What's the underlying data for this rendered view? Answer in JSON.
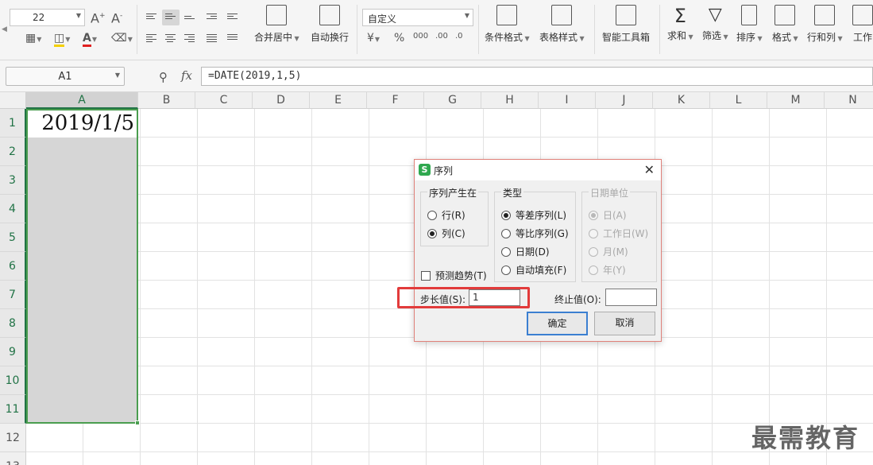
{
  "ribbon": {
    "font_size": "22",
    "merge_center_label": "合并居中",
    "wrap_text_label": "自动换行",
    "number_format": "自定义",
    "cond_format_label": "条件格式",
    "table_style_label": "表格样式",
    "smart_tools_label": "智能工具箱",
    "sum_label": "求和",
    "filter_label": "筛选",
    "sort_label": "排序",
    "format_label": "格式",
    "row_col_label": "行和列",
    "worksheet_label": "工作"
  },
  "formula_bar": {
    "cell_ref": "A1",
    "fx": "fx",
    "formula": "=DATE(2019,1,5)"
  },
  "grid": {
    "columns": [
      "A",
      "B",
      "C",
      "D",
      "E",
      "F",
      "G",
      "H",
      "I",
      "J",
      "K",
      "L",
      "M",
      "N"
    ],
    "rows": [
      "1",
      "2",
      "3",
      "4",
      "5",
      "6",
      "7",
      "8",
      "9",
      "10",
      "11",
      "12",
      "13"
    ],
    "a1_value": "2019/1/5"
  },
  "dialog": {
    "title": "序列",
    "close": "✕",
    "series_in": {
      "title": "序列产生在",
      "options": [
        "行(R)",
        "列(C)"
      ],
      "selected": "列(C)"
    },
    "type": {
      "title": "类型",
      "options": [
        "等差序列(L)",
        "等比序列(G)",
        "日期(D)",
        "自动填充(F)"
      ],
      "selected": "等差序列(L)"
    },
    "date_unit": {
      "title": "日期单位",
      "options": [
        "日(A)",
        "工作日(W)",
        "月(M)",
        "年(Y)"
      ],
      "selected": "日(A)",
      "disabled": true
    },
    "trend_label": "预测趋势(T)",
    "step_label": "步长值(S):",
    "step_value": "1",
    "stop_label": "终止值(O):",
    "stop_value": "",
    "ok_label": "确定",
    "cancel_label": "取消"
  },
  "watermark": "最需教育",
  "colors": {
    "selection_border": "#4a9d4f",
    "highlight_red": "#e23b3b",
    "primary_button_border": "#3b7fd1",
    "wps_green": "#2fa84f"
  }
}
